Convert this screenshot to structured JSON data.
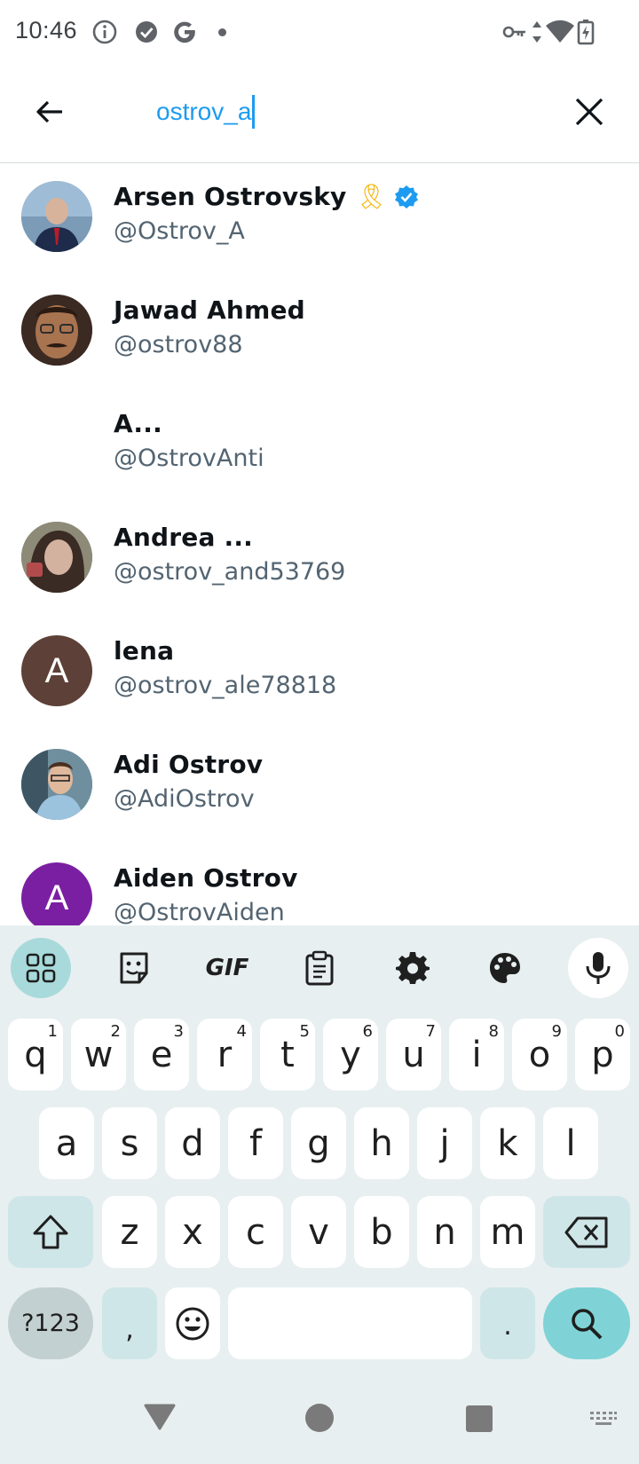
{
  "status_bar": {
    "time": "10:46",
    "icons": [
      "info-icon",
      "check-circle-icon",
      "google-icon",
      "notification-dot",
      "vpn-key-icon",
      "data-arrows-icon",
      "wifi-icon",
      "battery-charging-icon"
    ]
  },
  "search": {
    "query": "ostrov_a",
    "back_icon": "arrow-left-icon",
    "clear_icon": "close-icon"
  },
  "results": [
    {
      "name": "Arsen Ostrovsky",
      "handle": "@Ostrov_A",
      "emoji": "🎗",
      "verified": true,
      "avatar_kind": "photo",
      "avatar_color": "#6b8fb3"
    },
    {
      "name": "Jawad Ahmed",
      "handle": "@ostrov88",
      "emoji": "",
      "verified": false,
      "avatar_kind": "photo",
      "avatar_color": "#5a3b2a"
    },
    {
      "name": "A...",
      "handle": "@OstrovAnti",
      "emoji": "",
      "verified": false,
      "avatar_kind": "none",
      "avatar_color": "#ffffff"
    },
    {
      "name": "Andrea ...",
      "handle": "@ostrov_and53769",
      "emoji": "",
      "verified": false,
      "avatar_kind": "photo",
      "avatar_color": "#6e6a5c"
    },
    {
      "name": "lena",
      "handle": "@ostrov_ale78818",
      "emoji": "",
      "verified": false,
      "avatar_kind": "letter",
      "avatar_letter": "A",
      "avatar_color": "#5d4037"
    },
    {
      "name": "Adi Ostrov",
      "handle": "@AdiOstrov",
      "emoji": "",
      "verified": false,
      "avatar_kind": "photo",
      "avatar_color": "#4f7a8f"
    },
    {
      "name": "Aiden Ostrov",
      "handle": "@OstrovAiden",
      "emoji": "",
      "verified": false,
      "avatar_kind": "letter",
      "avatar_letter": "A",
      "avatar_color": "#7b1fa2"
    }
  ],
  "keyboard": {
    "toolbar": [
      "apps-grid-icon",
      "sticker-icon",
      "GIF",
      "clipboard-icon",
      "settings-gear-icon",
      "palette-icon",
      "microphone-icon"
    ],
    "gif_label": "GIF",
    "row1": [
      "q",
      "w",
      "e",
      "r",
      "t",
      "y",
      "u",
      "i",
      "o",
      "p"
    ],
    "row1_hints": [
      "1",
      "2",
      "3",
      "4",
      "5",
      "6",
      "7",
      "8",
      "9",
      "0"
    ],
    "row2": [
      "a",
      "s",
      "d",
      "f",
      "g",
      "h",
      "j",
      "k",
      "l"
    ],
    "row3": [
      "z",
      "x",
      "c",
      "v",
      "b",
      "n",
      "m"
    ],
    "symbols_label": "?123",
    "comma_label": ",",
    "period_label": ".",
    "colors": {
      "key": "#ffffff",
      "mod_key": "#cfe6e8",
      "action_key": "#7fd3d6",
      "background": "#e8eff0"
    }
  },
  "accent_color": "#1d9bf0",
  "verified_color": "#1d9bf0"
}
